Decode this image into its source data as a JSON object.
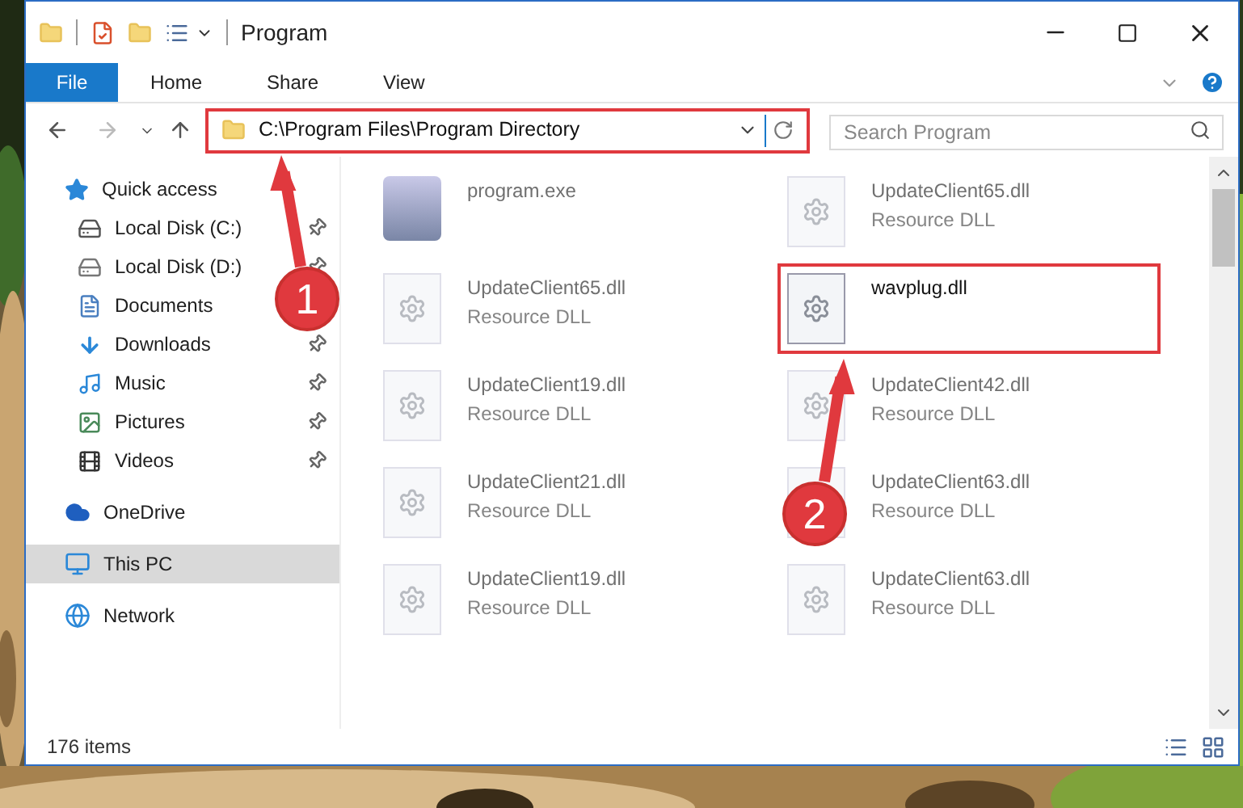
{
  "window": {
    "title": "Program"
  },
  "ribbon_tabs": [
    {
      "label": "File",
      "selected": true
    },
    {
      "label": "Home",
      "selected": false
    },
    {
      "label": "Share",
      "selected": false
    },
    {
      "label": "View",
      "selected": false
    }
  ],
  "address_bar": {
    "path": "C:\\Program Files\\Program Directory",
    "highlighted": true
  },
  "search": {
    "placeholder": "Search Program"
  },
  "sidebar": {
    "items": [
      {
        "label": "Quick access",
        "kind": "quick",
        "selected": false,
        "children": [
          {
            "label": "Local Disk (C:)",
            "kind": "drive-c",
            "pinned": true,
            "selected": false
          },
          {
            "label": "Local Disk (D:)",
            "kind": "drive",
            "pinned": true,
            "selected": false
          },
          {
            "label": "Documents",
            "kind": "documents",
            "selected": false
          },
          {
            "label": "Downloads",
            "kind": "downloads",
            "pinned": true,
            "selected": false
          },
          {
            "label": "Music",
            "kind": "music",
            "pinned": true,
            "selected": false
          },
          {
            "label": "Pictures",
            "kind": "pictures",
            "pinned": true,
            "selected": false
          },
          {
            "label": "Videos",
            "kind": "videos",
            "pinned": true,
            "selected": false
          }
        ]
      },
      {
        "label": "OneDrive",
        "kind": "onedrive",
        "selected": false
      },
      {
        "label": "This PC",
        "kind": "pc",
        "selected": true
      },
      {
        "label": "Network",
        "kind": "network",
        "selected": false
      }
    ]
  },
  "files": [
    {
      "name": "program.exe",
      "kind": "exe",
      "highlighted": false
    },
    {
      "name": "UpdateClient65.dll",
      "type": "Resource DLL",
      "kind": "dll",
      "highlighted": false
    },
    {
      "name": "UpdateClient65.dll",
      "type": "Resource DLL",
      "kind": "dll",
      "highlighted": false
    },
    {
      "name": "wavplug.dll",
      "kind": "dll",
      "highlighted": true
    },
    {
      "name": "UpdateClient19.dll",
      "type": "Resource DLL",
      "kind": "dll",
      "highlighted": false
    },
    {
      "name": "UpdateClient42.dll",
      "type": "Resource DLL",
      "kind": "dll",
      "highlighted": false
    },
    {
      "name": "UpdateClient21.dll",
      "type": "Resource DLL",
      "kind": "dll",
      "highlighted": false
    },
    {
      "name": "UpdateClient63.dll",
      "type": "Resource DLL",
      "kind": "dll",
      "highlighted": false
    },
    {
      "name": "UpdateClient19.dll",
      "type": "Resource DLL",
      "kind": "dll",
      "highlighted": false
    },
    {
      "name": "UpdateClient63.dll",
      "type": "Resource DLL",
      "kind": "dll",
      "highlighted": false
    }
  ],
  "status_bar": {
    "item_count": "176 items"
  },
  "callouts": [
    {
      "number": "1"
    },
    {
      "number": "2"
    }
  ]
}
